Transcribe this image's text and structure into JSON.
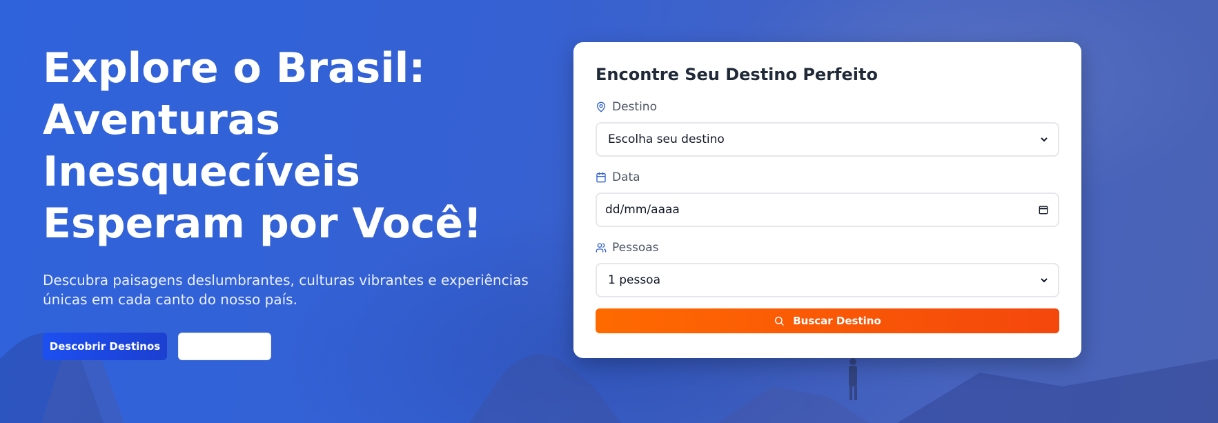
{
  "hero": {
    "title": "Explore o Brasil: Aventuras Inesquecíveis Esperam por Você!",
    "subtitle": "Descubra paisagens deslumbrantes, culturas vibrantes e experiências únicas em cada canto do nosso país.",
    "primary_button": "Descobrir Destinos",
    "secondary_button": ""
  },
  "search_card": {
    "title": "Encontre Seu Destino Perfeito",
    "destination": {
      "label": "Destino",
      "selected": "Escolha seu destino",
      "icon": "map-pin-icon"
    },
    "date": {
      "label": "Data",
      "value": "dd/mm/aaaa",
      "icon": "calendar-icon"
    },
    "people": {
      "label": "Pessoas",
      "selected": "1 pessoa",
      "icon": "users-icon"
    },
    "search_button": {
      "label": "Buscar Destino",
      "icon": "search-icon"
    }
  },
  "colors": {
    "hero_background": "#3561d3",
    "primary_button": "#1d4ff0",
    "search_button": "#ff6a00",
    "icon_accent": "#2f5fd0",
    "card_background": "#ffffff"
  }
}
